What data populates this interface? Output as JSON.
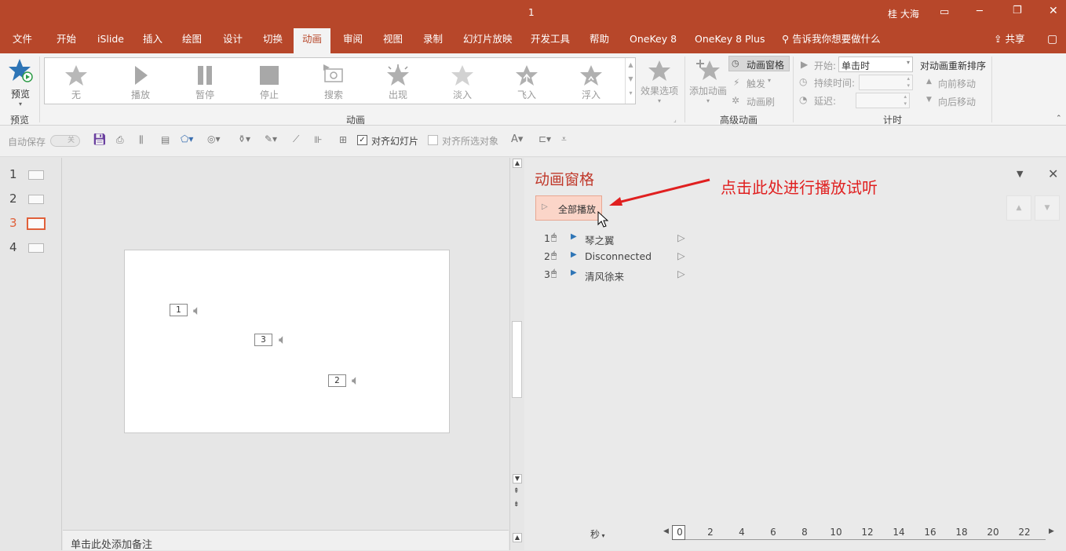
{
  "title_bar": {
    "doc_title": "1",
    "user": "桂 大海",
    "minimize": "─",
    "restore": "❐",
    "close": "✕"
  },
  "tabs": [
    "文件",
    "开始",
    "iSlide",
    "插入",
    "绘图",
    "设计",
    "切换",
    "动画",
    "审阅",
    "视图",
    "录制",
    "幻灯片放映",
    "开发工具",
    "帮助",
    "OneKey 8",
    "OneKey 8 Plus"
  ],
  "tell_me": "告诉我你想要做什么",
  "share": "共享",
  "ribbon": {
    "preview_label": "预览",
    "preview_group": "预览",
    "gallery": [
      "无",
      "播放",
      "暂停",
      "停止",
      "搜索",
      "出现",
      "淡入",
      "飞入",
      "浮入"
    ],
    "effect_options": "效果选项",
    "animation_group": "动画",
    "add_animation": "添加动画",
    "animation_pane_btn": "动画窗格",
    "trigger": "触发",
    "anim_painter": "动画刷",
    "advanced_group": "高级动画",
    "start_label": "开始:",
    "start_value": "单击时",
    "duration_label": "持续时间:",
    "delay_label": "延迟:",
    "timing_group": "计时",
    "reorder_title": "对动画重新排序",
    "move_earlier": "向前移动",
    "move_later": "向后移动"
  },
  "qat": {
    "autosave": "自动保存",
    "autosave_state": "关",
    "align_slide": "对齐幻灯片",
    "align_selected": "对齐所选对象"
  },
  "slides": [
    {
      "num": "1"
    },
    {
      "num": "2"
    },
    {
      "num": "3"
    },
    {
      "num": "4"
    }
  ],
  "slide_markers": [
    "1",
    "3",
    "2"
  ],
  "notes_placeholder": "单击此处添加备注",
  "animation_pane": {
    "title": "动画窗格",
    "play_all": "全部播放",
    "annotation": "点击此处进行播放试听",
    "items": [
      {
        "num": "1",
        "name": "琴之翼"
      },
      {
        "num": "2",
        "name": "Disconnected"
      },
      {
        "num": "3",
        "name": "清风徐来"
      }
    ],
    "unit": "秒",
    "timeline_ticks": [
      "0",
      "2",
      "4",
      "6",
      "8",
      "10",
      "12",
      "14",
      "16",
      "18",
      "20",
      "22"
    ]
  },
  "colors": {
    "accent": "#b7472a",
    "annotation": "#e02020",
    "play_icon": "#2e75b6",
    "selected_slide": "#e0603a"
  }
}
